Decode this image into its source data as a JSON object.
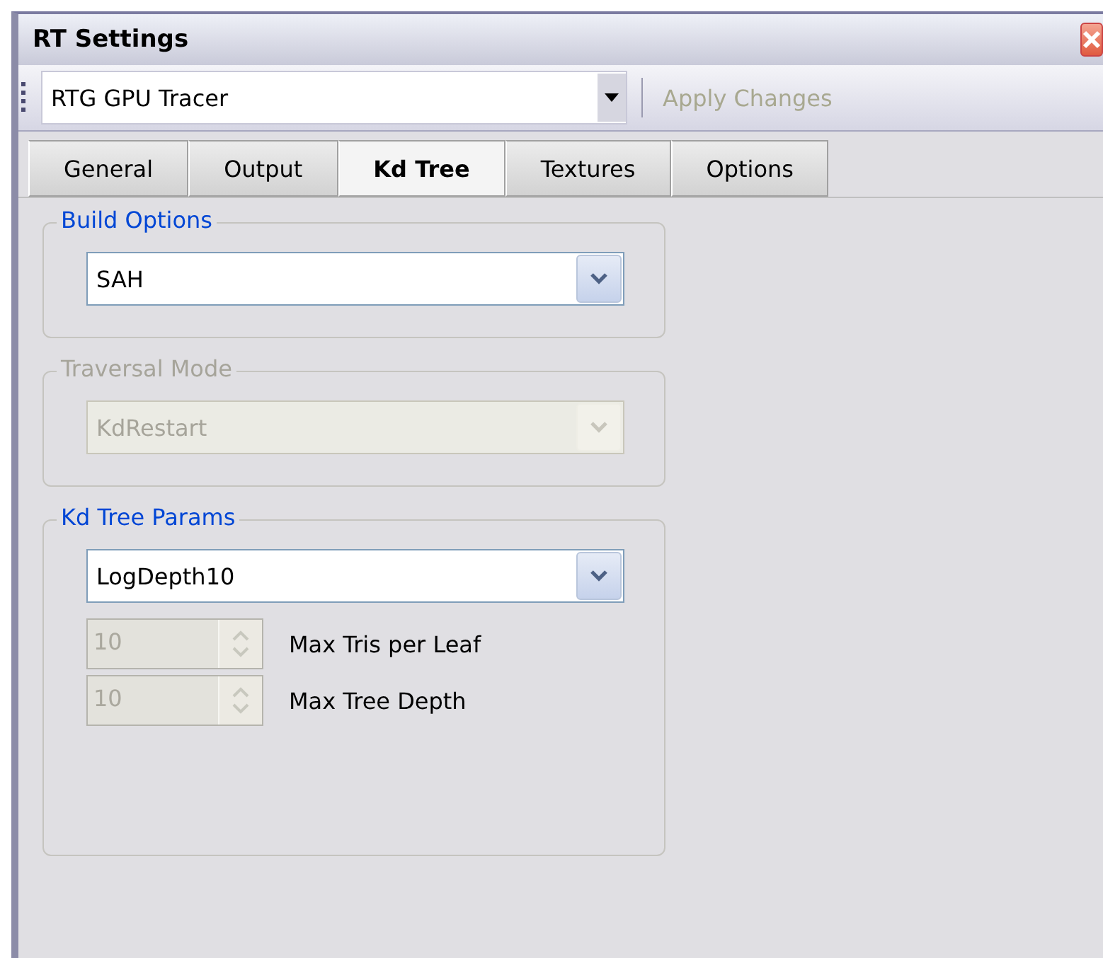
{
  "window": {
    "title": "RT Settings"
  },
  "toolbar": {
    "renderer": {
      "value": "RTG GPU Tracer"
    },
    "apply_button": {
      "label": "Apply Changes",
      "disabled": true
    }
  },
  "tabs": [
    {
      "label": "General",
      "selected": false
    },
    {
      "label": "Output",
      "selected": false
    },
    {
      "label": "Kd Tree",
      "selected": true
    },
    {
      "label": "Textures",
      "selected": false
    },
    {
      "label": "Options",
      "selected": false
    }
  ],
  "groups": [
    {
      "title": "Build Options",
      "disabled": false,
      "combo": {
        "value": "SAH"
      }
    },
    {
      "title": "Traversal Mode",
      "disabled": true,
      "combo": {
        "value": "KdRestart"
      }
    },
    {
      "title": "Kd Tree Params",
      "disabled": false,
      "combo": {
        "value": "LogDepth10"
      },
      "spinners": [
        {
          "value": "10",
          "label": "Max Tris per Leaf",
          "disabled": true
        },
        {
          "value": "10",
          "label": "Max Tree Depth",
          "disabled": true
        }
      ]
    }
  ]
}
